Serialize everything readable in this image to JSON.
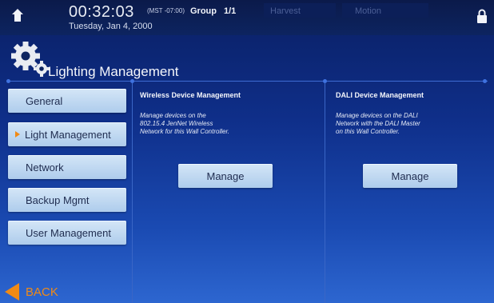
{
  "statusbar": {
    "time": "00:32:03",
    "timezone": "(MST -07:00)",
    "date": "Tuesday, Jan 4, 2000",
    "group_label": "Group",
    "group_count": "1/1",
    "harvest_label": "Harvest",
    "motion_label": "Motion",
    "icons": [
      "home-icon",
      "lock-icon"
    ]
  },
  "header": {
    "title": "Lighting Management",
    "icon": "gear-icon"
  },
  "nav": {
    "items": [
      {
        "label": "General"
      },
      {
        "label": "Light Management",
        "selected": true
      },
      {
        "label": "Network"
      },
      {
        "label": "Backup Mgmt"
      },
      {
        "label": "User Management"
      }
    ]
  },
  "panels": [
    {
      "title": "Wireless Device Management",
      "description_lines": [
        "Manage devices on the",
        "802.15.4 JenNet Wireless",
        "Network for this Wall Controller."
      ],
      "button_label": "Manage"
    },
    {
      "title": "DALI Device Management",
      "description_lines": [
        "Manage devices on the DALI",
        "Network with the DALI Master",
        "on this Wall Controller."
      ],
      "button_label": "Manage"
    }
  ],
  "footer": {
    "back_label": "BACK"
  },
  "colors": {
    "accent": "#f08a16",
    "button_top": "#d4e6f7",
    "button_bottom": "#aeccec",
    "background_top": "#0a1f63",
    "background_bottom": "#2d66d0"
  }
}
